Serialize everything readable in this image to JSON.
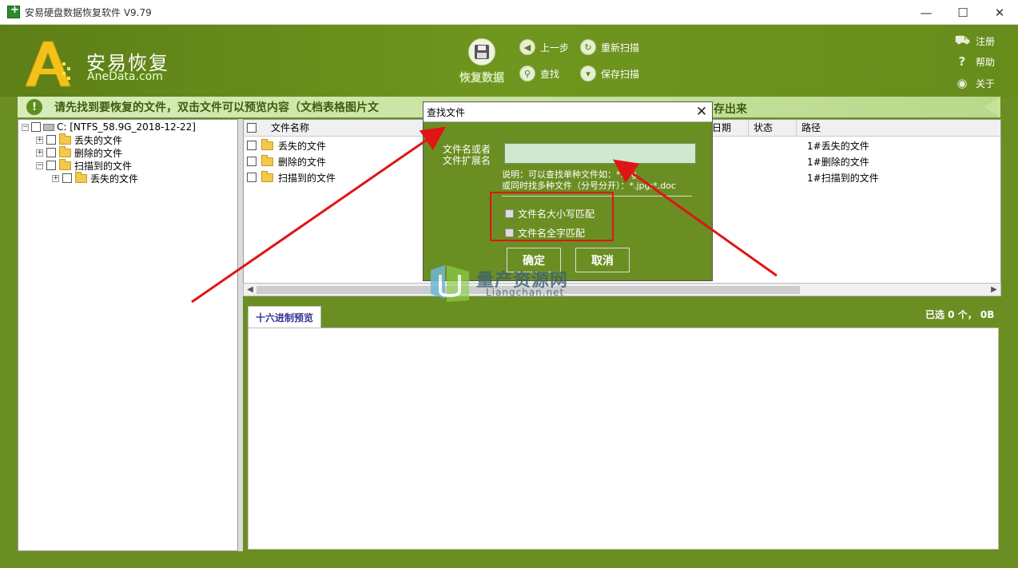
{
  "window": {
    "title": "安易硬盘数据恢复软件 V9.79",
    "min": "—",
    "max": "☐",
    "close": "✕"
  },
  "header": {
    "logo_cn": "安易恢复",
    "logo_en": "AneData.com",
    "recover_label": "恢复数据",
    "tools": {
      "back": "上一步",
      "rescan": "重新扫描",
      "find": "查找",
      "save_scan": "保存扫描"
    },
    "side": {
      "register": "注册",
      "help": "帮助",
      "about": "关于"
    }
  },
  "notice": {
    "text": "请先找到要恢复的文件，双击文件可以预览内容（文档表格图片文",
    "tail": "存出来"
  },
  "tree": {
    "drive": "C:  [NTFS_58.9G_2018-12-22]",
    "items": [
      "丢失的文件",
      "删除的文件",
      "扫描到的文件"
    ],
    "child": "丢失的文件"
  },
  "file_list": {
    "columns": {
      "name": "文件名称",
      "date": "日期",
      "status": "状态",
      "path": "路径"
    },
    "rows": [
      {
        "name": "丢失的文件",
        "path": "1#丢失的文件"
      },
      {
        "name": "删除的文件",
        "path": "1#删除的文件"
      },
      {
        "name": "扫描到的文件",
        "path": "1#扫描到的文件"
      }
    ]
  },
  "preview": {
    "tab": "十六进制预览",
    "selected": "已选 0 个， 0B"
  },
  "dialog": {
    "title": "查找文件",
    "label_line1": "文件名或者",
    "label_line2": "文件扩展名",
    "input_value": "",
    "note_line1": "说明：可以查找单种文件如：*.jpg",
    "note_line2": "或同时找多种文件（分号分开）：*.jpg;*.doc",
    "check_case": "文件名大小写匹配",
    "check_whole": "文件名全字匹配",
    "ok": "确定",
    "cancel": "取消"
  },
  "watermark": {
    "cn": "量产资源网",
    "en": "Liangchan.net"
  },
  "colors": {
    "app_green": "#6b8e23",
    "annotation_red": "#e01515"
  }
}
